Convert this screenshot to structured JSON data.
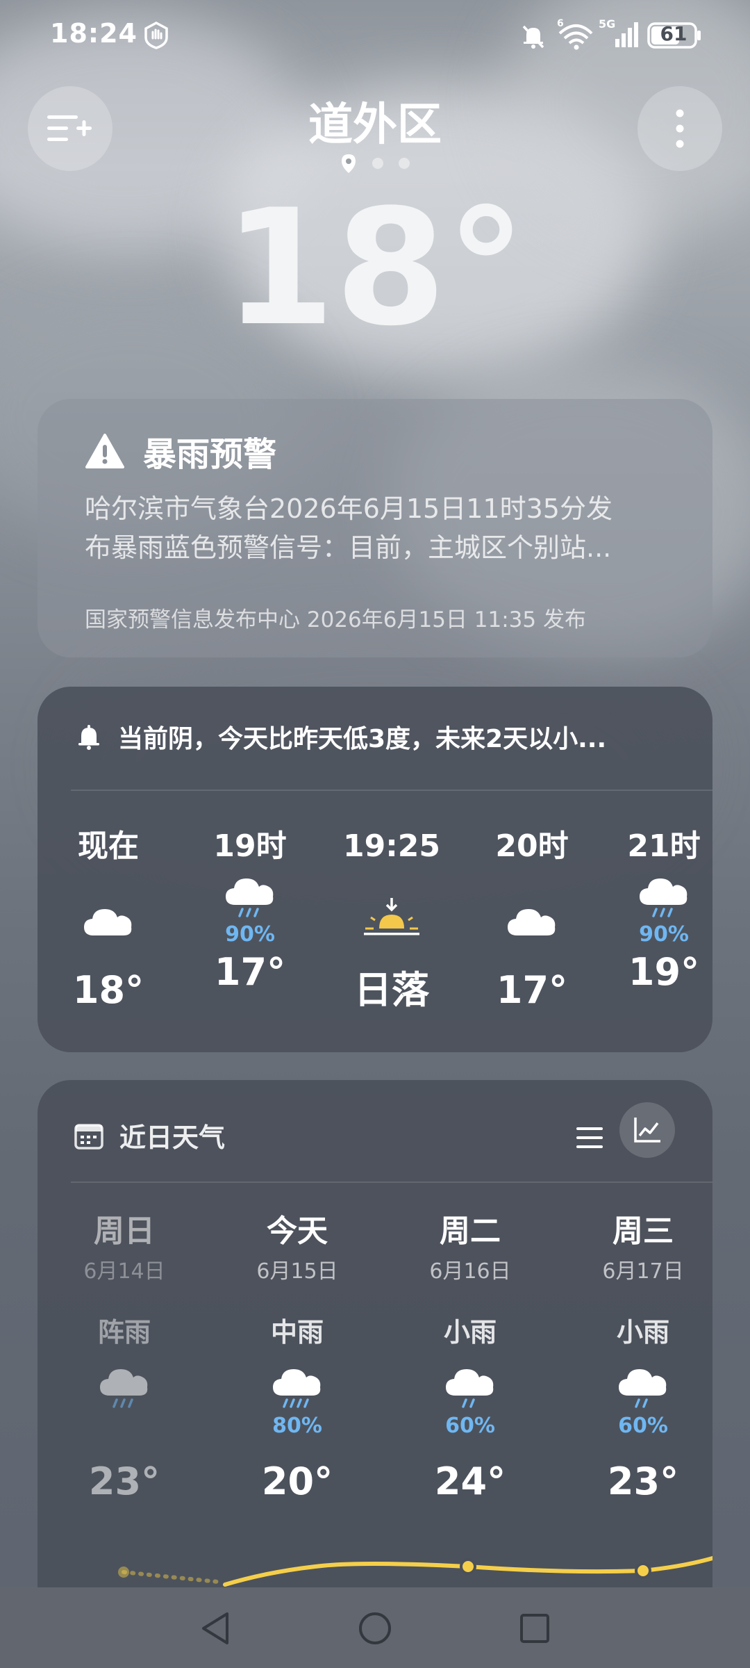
{
  "status_bar": {
    "time": "18:24",
    "battery": "61",
    "network": "5G",
    "icons": [
      "shield-hand-icon",
      "bell-off-icon",
      "wifi-icon",
      "signal-icon",
      "battery-icon"
    ]
  },
  "header": {
    "location": "道外区",
    "current_temp": "18°",
    "page_dots": 3
  },
  "alert": {
    "title": "暴雨预警",
    "line1": "哈尔滨市气象台2026年6月15日11时35分发",
    "line2": "布暴雨蓝色预警信号：目前，主城区个别站...",
    "source": "国家预警信息发布中心 2026年6月15日 11:35 发布"
  },
  "hourly": {
    "summary": "当前阴，今天比昨天低3度，未来2天以小...",
    "items": [
      {
        "label": "现在",
        "icon": "cloudy-icon",
        "pop": "",
        "temp": "18°"
      },
      {
        "label": "19时",
        "icon": "rain-cloud-icon",
        "pop": "90%",
        "temp": "17°"
      },
      {
        "label": "19:25",
        "icon": "sunset-icon",
        "pop": "",
        "temp": "日落"
      },
      {
        "label": "20时",
        "icon": "cloudy-icon",
        "pop": "",
        "temp": "17°"
      },
      {
        "label": "21时",
        "icon": "rain-cloud-icon",
        "pop": "90%",
        "temp": "19°"
      }
    ]
  },
  "daily": {
    "title": "近日天气",
    "days": [
      {
        "name": "周日",
        "date": "6月14日",
        "condition": "阵雨",
        "pop": "",
        "temp": "23°",
        "past": true
      },
      {
        "name": "今天",
        "date": "6月15日",
        "condition": "中雨",
        "pop": "80%",
        "temp": "20°",
        "past": false
      },
      {
        "name": "周二",
        "date": "6月16日",
        "condition": "小雨",
        "pop": "60%",
        "temp": "24°",
        "past": false
      },
      {
        "name": "周三",
        "date": "6月17日",
        "condition": "小雨",
        "pop": "60%",
        "temp": "23°",
        "past": false
      }
    ]
  },
  "colors": {
    "accent_blue": "#6fb7f2",
    "trend_yellow": "#f5cf4a",
    "sun_yellow": "#f3c84b"
  }
}
